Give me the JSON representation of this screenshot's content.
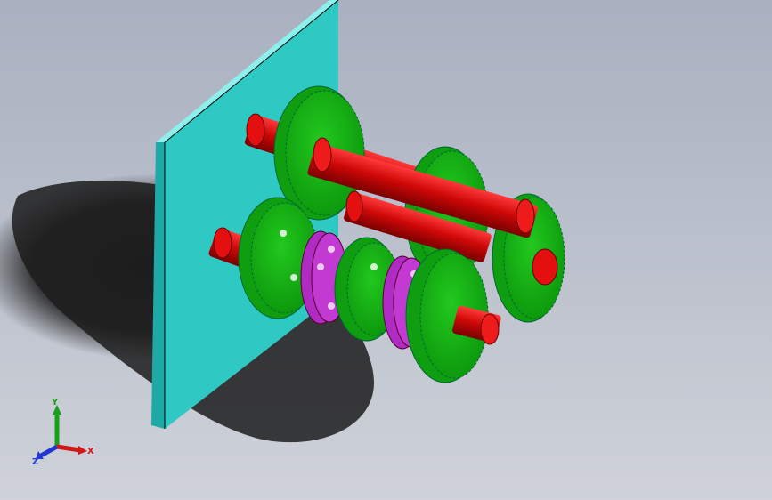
{
  "viewport": {
    "background_top": "#a9b0bf",
    "background_bottom": "#cfd2d9"
  },
  "model": {
    "plate_color": "#2fc9c4",
    "gear_color": "#16b016",
    "shaft_color": "#d20a0a",
    "coupling_color": "#c23ad2"
  },
  "triad": {
    "x_label": "X",
    "y_label": "Y",
    "z_label": "Z",
    "x_color": "#d01818",
    "y_color": "#18a018",
    "z_color": "#2038d0"
  }
}
